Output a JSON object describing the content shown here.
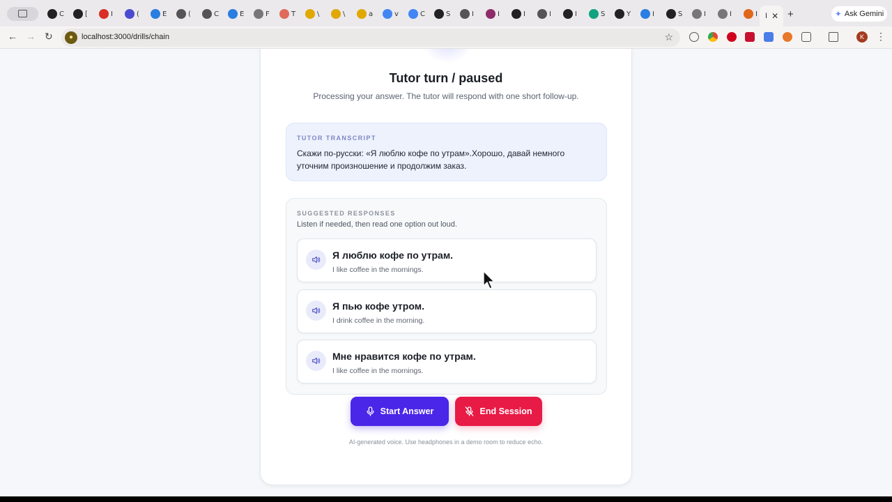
{
  "browser": {
    "address": "localhost:3000/drills/chain",
    "ask_gemini_label": "Ask Gemini",
    "new_tab_glyph": "+",
    "active_tab_fragment": "I",
    "profile_initial": "K",
    "tabs": [
      {
        "icon": "analytics-icon",
        "fragment": "C",
        "color": "#222222"
      },
      {
        "icon": "analytics-icon",
        "fragment": "[",
        "color": "#222222"
      },
      {
        "icon": "gmail-icon",
        "fragment": "I",
        "color": "#d93025"
      },
      {
        "icon": "app-icon",
        "fragment": "(",
        "color": "#4b4bd0"
      },
      {
        "icon": "globe-icon",
        "fragment": "E",
        "color": "#2a7de1"
      },
      {
        "icon": "clock-icon",
        "fragment": "(",
        "color": "#555555"
      },
      {
        "icon": "clock-icon",
        "fragment": "C",
        "color": "#555555"
      },
      {
        "icon": "puzzle-icon",
        "fragment": "E",
        "color": "#2a7de1"
      },
      {
        "icon": "settings-icon",
        "fragment": "F",
        "color": "#777777"
      },
      {
        "icon": "cube-icon",
        "fragment": "T",
        "color": "#e06a5a"
      },
      {
        "icon": "face-icon",
        "fragment": "\\",
        "color": "#e0a800"
      },
      {
        "icon": "face-icon",
        "fragment": "\\",
        "color": "#e0a800"
      },
      {
        "icon": "face-icon",
        "fragment": "a",
        "color": "#e0a800"
      },
      {
        "icon": "google-icon",
        "fragment": "v",
        "color": "#4285f4"
      },
      {
        "icon": "google-icon",
        "fragment": "C",
        "color": "#4285f4"
      },
      {
        "icon": "github-icon",
        "fragment": "S",
        "color": "#222222"
      },
      {
        "icon": "chrome-icon",
        "fragment": "I",
        "color": "#555555"
      },
      {
        "icon": "twitch-icon",
        "fragment": "I",
        "color": "#8e2c6a"
      },
      {
        "icon": "github-icon",
        "fragment": "I",
        "color": "#222222"
      },
      {
        "icon": "chrome-icon",
        "fragment": "I",
        "color": "#555555"
      },
      {
        "icon": "github-icon",
        "fragment": "I",
        "color": "#222222"
      },
      {
        "icon": "openai-icon",
        "fragment": "S",
        "color": "#10a37f"
      },
      {
        "icon": "github-icon",
        "fragment": "Y",
        "color": "#222222"
      },
      {
        "icon": "star-icon",
        "fragment": "I",
        "color": "#2a7de1"
      },
      {
        "icon": "clock-icon",
        "fragment": "S",
        "color": "#222222"
      },
      {
        "icon": "globe-icon",
        "fragment": "I",
        "color": "#777777"
      },
      {
        "icon": "globe-icon",
        "fragment": "I",
        "color": "#777777"
      },
      {
        "icon": "flame-icon",
        "fragment": "I",
        "color": "#e0661a"
      }
    ]
  },
  "status": {
    "title": "Tutor turn / paused",
    "subtitle": "Processing your answer. The tutor will respond with one short follow-up."
  },
  "transcript": {
    "label": "TUTOR TRANSCRIPT",
    "text": "Скажи по-русски: «Я люблю кофе по утрам».Хорошо, давай немного уточним произношение и продолжим заказ."
  },
  "responses": {
    "label": "SUGGESTED RESPONSES",
    "hint": "Listen if needed, then read one option out loud.",
    "options": [
      {
        "ru": "Я люблю кофе по утрам.",
        "en": "I like coffee in the mornings."
      },
      {
        "ru": "Я пью кофе утром.",
        "en": "I drink coffee in the morning."
      },
      {
        "ru": "Мне нравится кофе по утрам.",
        "en": "I like coffee in the mornings."
      }
    ]
  },
  "actions": {
    "start_label": "Start Answer",
    "end_label": "End Session"
  },
  "footnote": "AI-generated voice. Use headphones in a demo room to reduce echo.",
  "colors": {
    "start_button": "#4a26e8",
    "end_button": "#e81a46",
    "transcript_bg": "#edf2fd"
  }
}
